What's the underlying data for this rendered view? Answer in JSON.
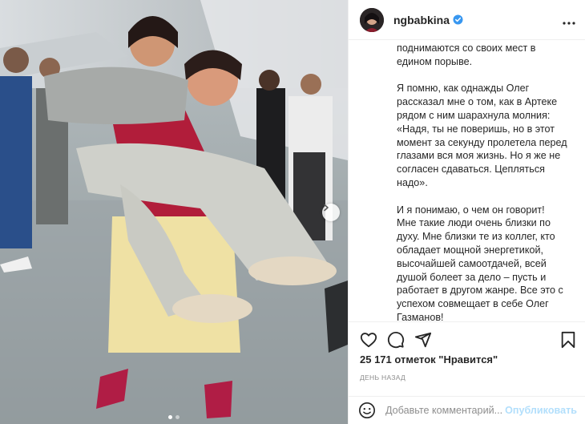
{
  "header": {
    "username": "ngbabkina",
    "more_icon": "more-horizontal-icon",
    "verified_icon": "verified-badge-icon"
  },
  "caption": {
    "paragraphs": [
      [
        "поднимаются со своих мест в",
        "едином порыве."
      ],
      [
        "Я помню, как однажды Олег",
        "рассказал мне о том, как в Артеке",
        "рядом с ним шарахнула молния:",
        "«Надя, ты не поверишь, но в этот",
        "момент за секунду пролетела перед",
        "глазами вся моя жизнь. Но я же не",
        "согласен сдаваться. Цепляться",
        "надо»."
      ],
      [
        "И я понимаю, о чем он говорит!",
        "Мне такие люди очень близки по",
        "духу. Мне близки те из коллег, кто",
        "обладает мощной энергетикой,",
        "высочайшей самоотдачей, всей",
        "душой болеет за дело – пусть и",
        "работает в другом жанре. Все это с",
        "успехом совмещает в себе Олег",
        "Газманов!"
      ]
    ]
  },
  "actions": {
    "like_icon": "heart-icon",
    "comment_icon": "comment-icon",
    "share_icon": "share-icon",
    "save_icon": "bookmark-icon"
  },
  "likes_text": "25 171 отметок \"Нравится\"",
  "timestamp": "ДЕНЬ НАЗАД",
  "comment": {
    "placeholder": "Добавьте комментарий...",
    "publish_label": "Опубликовать",
    "emoji_icon": "emoji-icon"
  },
  "carousel": {
    "total": 2,
    "current": 1,
    "next_icon": "chevron-right-icon"
  },
  "colors": {
    "verified": "#3897f0",
    "publish_disabled": "#b2dffc",
    "muted_text": "#8e8e8e"
  }
}
